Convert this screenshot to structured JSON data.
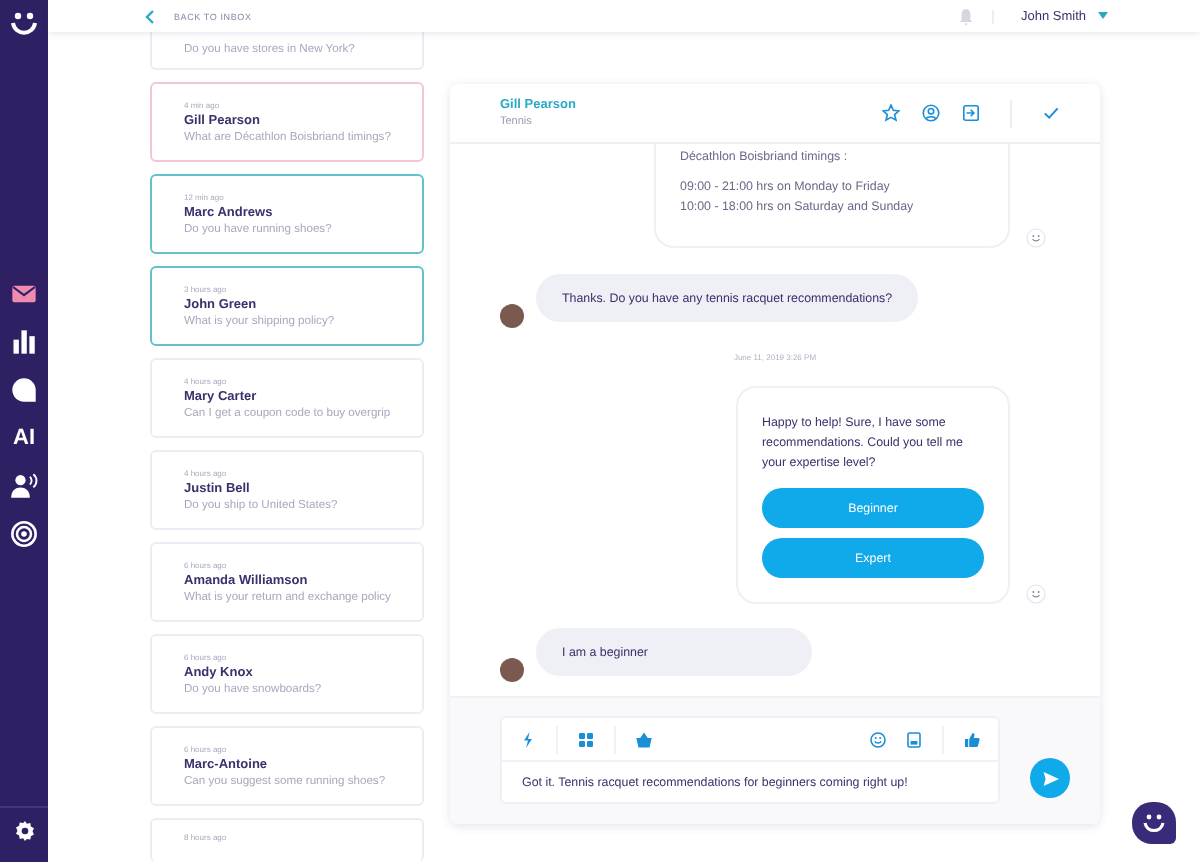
{
  "sidebar": {
    "items": [
      {
        "kind": "icon",
        "selected": true
      },
      {
        "kind": "icon",
        "selected": false
      },
      {
        "kind": "icon",
        "selected": false
      },
      {
        "kind": "text",
        "label": "AI",
        "selected": false
      },
      {
        "kind": "icon",
        "selected": false
      },
      {
        "kind": "icon",
        "selected": false
      }
    ]
  },
  "top_bar": {
    "back_link": "BACK TO INBOX",
    "user": "John Smith"
  },
  "conversations": [
    {
      "preview": "Do you have stores in New York?",
      "color": "#ececf3"
    },
    {
      "time": "4 min ago",
      "name": "Gill Pearson",
      "preview": "What are Décathlon Boisbriand timings?",
      "color": "#f2c7cf"
    },
    {
      "time": "12 min ago",
      "name": "Marc Andrews",
      "preview": "Do you have running shoes?",
      "color": "#62c2cc"
    },
    {
      "time": "3 hours ago",
      "name": "John Green",
      "preview": "What is your shipping policy?",
      "color": "#62c2cc"
    },
    {
      "time": "4 hours ago",
      "name": "Mary Carter",
      "preview": "Can I get a coupon code to buy overgrip",
      "color": "#ececf3"
    },
    {
      "time": "4 hours ago",
      "name": "Justin Bell",
      "preview": "Do you ship to United States?",
      "color": "#ececf3"
    },
    {
      "time": "6 hours ago",
      "name": "Amanda Williamson",
      "preview": "What is your return and exchange policy",
      "color": "#ececf3"
    },
    {
      "time": "6 hours ago",
      "name": "Andy Knox",
      "preview": "Do you have snowboards?",
      "color": "#ececf3"
    },
    {
      "time": "6 hours ago",
      "name": "Marc-Antoine",
      "preview": "Can you suggest some running shoes?",
      "color": "#ececf3"
    },
    {
      "time": "8 hours ago",
      "color": "#ececf3"
    }
  ],
  "chat": {
    "contact": "Gill Pearson",
    "topic": "Tennis",
    "messages": [
      {
        "kind": "bot_text",
        "heading": "Décathlon Boisbriand timings :",
        "lines": [
          "09:00 - 21:00 hrs on Monday to Friday",
          "10:00 - 18:00 hrs on Saturday and Sunday"
        ]
      },
      {
        "kind": "user",
        "text": "Thanks. Do you have any tennis racquet recommendations?"
      },
      {
        "kind": "timestamp",
        "text": "June 11, 2019 3:26 PM"
      },
      {
        "kind": "bot_options",
        "text": "Happy to help! Sure, I have some recommendations. Could you tell me your expertise level?",
        "options": [
          "Beginner",
          "Expert"
        ]
      },
      {
        "kind": "user",
        "text": "I am a beginner"
      }
    ],
    "composer": {
      "value": "Got it. Tennis racquet recommendations for beginners coming right up!"
    }
  }
}
